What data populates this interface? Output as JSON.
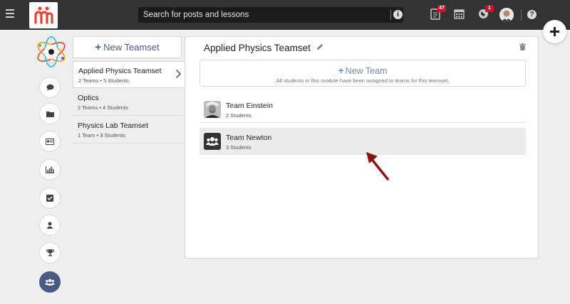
{
  "topbar": {
    "search_placeholder": "Search for posts and lessons",
    "notifications_count": "47",
    "globe_count": "1",
    "help_label": "?",
    "info_label": "i"
  },
  "icons": {
    "menu": "hamburger-icon",
    "logo": "app-logo",
    "notes": "notes-icon",
    "calendar": "calendar-icon",
    "globe": "globe-icon",
    "help": "help-icon",
    "add": "plus-icon"
  },
  "rail": {
    "items": [
      {
        "icon": "chat-icon"
      },
      {
        "icon": "folder-icon"
      },
      {
        "icon": "card-icon"
      },
      {
        "icon": "bar-chart-icon"
      },
      {
        "icon": "checkbox-icon"
      },
      {
        "icon": "user-icon"
      },
      {
        "icon": "trophy-icon"
      },
      {
        "icon": "group-icon",
        "active": true
      }
    ]
  },
  "teamsets": {
    "new_label": "New Teamset",
    "items": [
      {
        "name": "Applied Physics Teamset",
        "meta": "2 Teams • 5 Students",
        "selected": true
      },
      {
        "name": "Optics",
        "meta": "2 Teams • 4 Students"
      },
      {
        "name": "Physics Lab Teamset",
        "meta": "1 Team • 3 Students"
      }
    ]
  },
  "panel": {
    "title": "Applied Physics Teamset",
    "new_team_label": "New Team",
    "new_team_sub": "All students in this module have been assigned to teams for this teamset.",
    "teams": [
      {
        "name": "Team Einstein",
        "meta": "2 Students",
        "thumb": "photo"
      },
      {
        "name": "Team Newton",
        "meta": "3 Students",
        "thumb": "group-icon",
        "highlighted": true
      }
    ]
  },
  "colors": {
    "topbar": "#333333",
    "accent": "#4a5a84",
    "badge": "#c9152a",
    "arrow": "#8b1318"
  }
}
